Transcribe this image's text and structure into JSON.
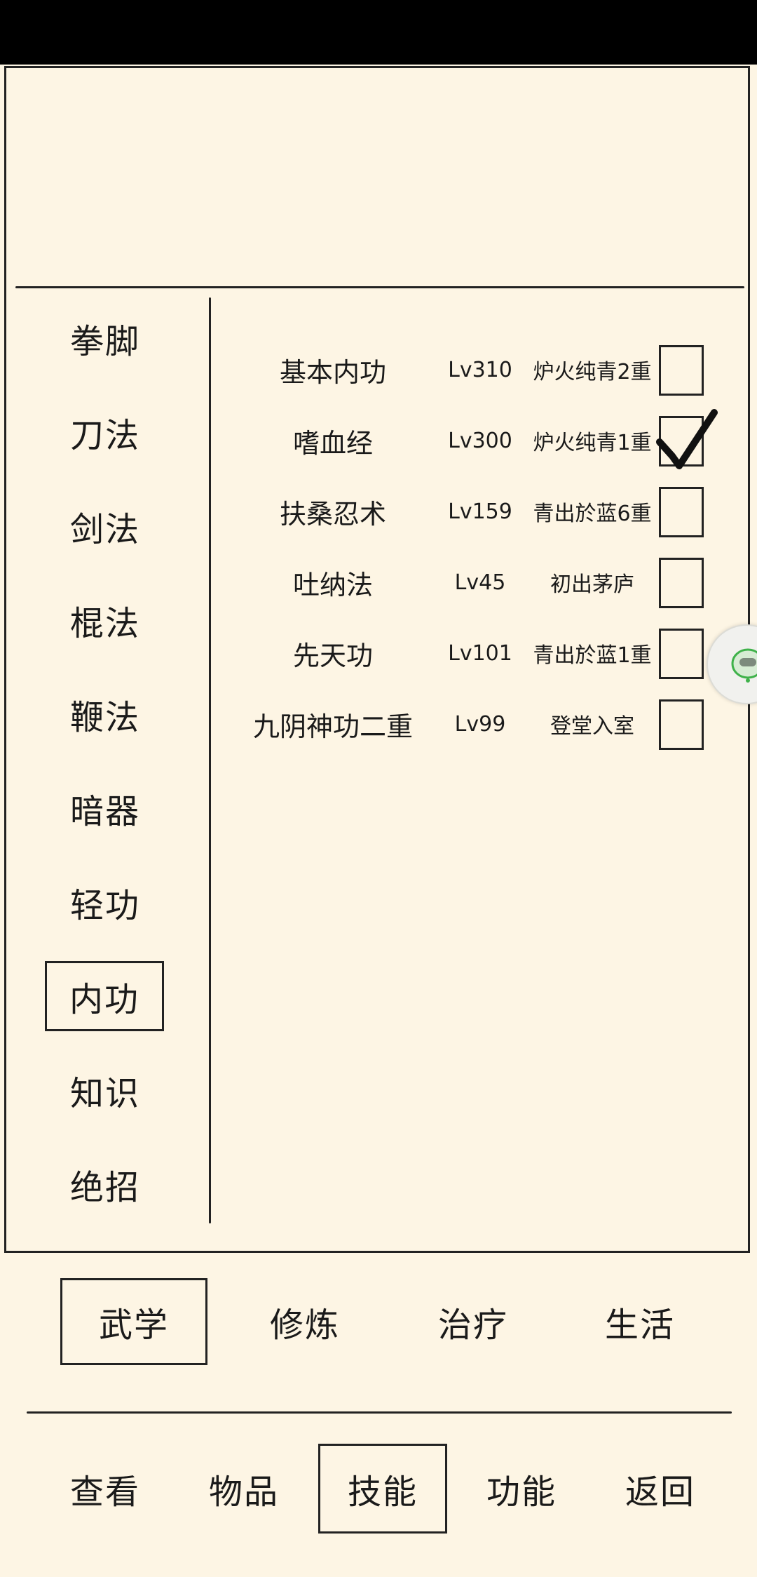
{
  "categories": [
    {
      "label": "拳脚"
    },
    {
      "label": "刀法"
    },
    {
      "label": "剑法"
    },
    {
      "label": "棍法"
    },
    {
      "label": "鞭法"
    },
    {
      "label": "暗器"
    },
    {
      "label": "轻功"
    },
    {
      "label": "内功",
      "selected": true
    },
    {
      "label": "知识"
    },
    {
      "label": "绝招"
    }
  ],
  "skills": [
    {
      "name": "基本内功",
      "level": "Lv310",
      "rank": "炉火纯青2重",
      "checked": false
    },
    {
      "name": "嗜血经",
      "level": "Lv300",
      "rank": "炉火纯青1重",
      "checked": true
    },
    {
      "name": "扶桑忍术",
      "level": "Lv159",
      "rank": "青出於蓝6重",
      "checked": false
    },
    {
      "name": "吐纳法",
      "level": "Lv45",
      "rank": "初出茅庐",
      "checked": false
    },
    {
      "name": "先天功",
      "level": "Lv101",
      "rank": "青出於蓝1重",
      "checked": false
    },
    {
      "name": "九阴神功二重",
      "level": "Lv99",
      "rank": "登堂入室",
      "checked": false
    }
  ],
  "tabs": [
    {
      "label": "武学",
      "selected": true
    },
    {
      "label": "修炼"
    },
    {
      "label": "治疗"
    },
    {
      "label": "生活"
    }
  ],
  "nav": [
    {
      "label": "查看"
    },
    {
      "label": "物品"
    },
    {
      "label": "技能",
      "selected": true
    },
    {
      "label": "功能"
    },
    {
      "label": "返回"
    }
  ],
  "float_button": {
    "icon": "assistant-bot-icon",
    "accent": "#3fb24a"
  }
}
